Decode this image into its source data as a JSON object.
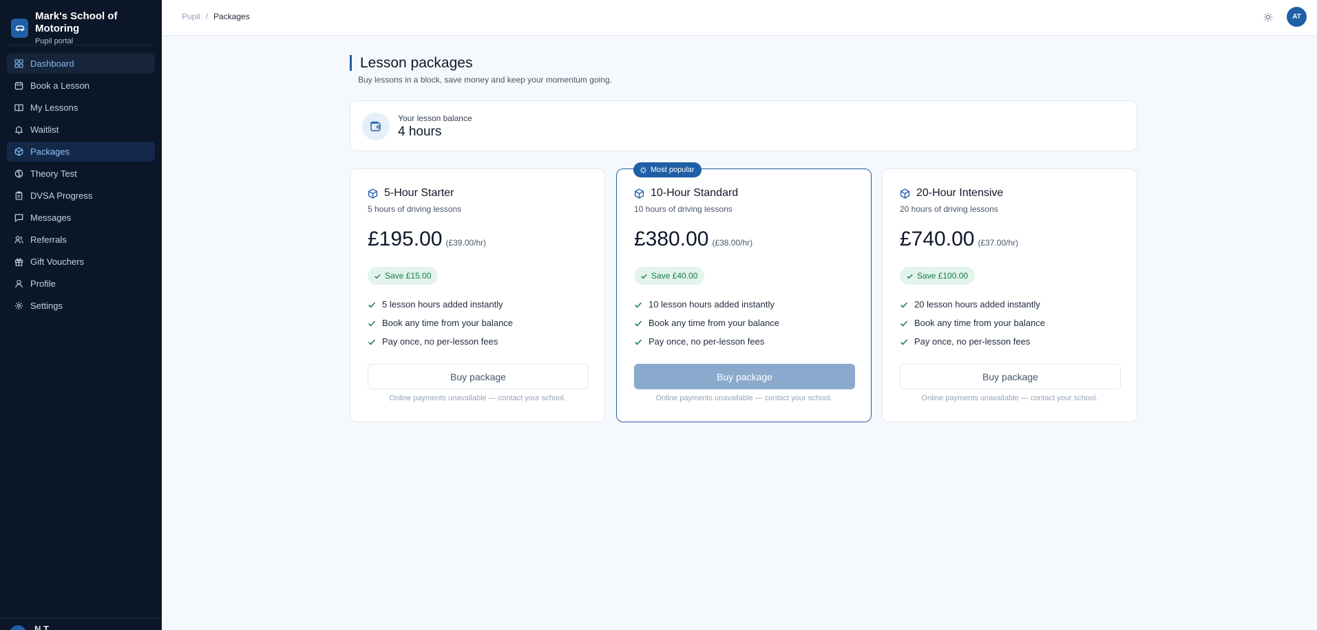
{
  "brand": {
    "name": "Mark's School of Motoring",
    "subtitle": "Pupil portal",
    "logo_icon": "car-icon"
  },
  "sidebar": {
    "items": [
      {
        "label": "Dashboard",
        "icon": "grid-icon"
      },
      {
        "label": "Book a Lesson",
        "icon": "calendar-icon"
      },
      {
        "label": "My Lessons",
        "icon": "book-icon"
      },
      {
        "label": "Waitlist",
        "icon": "bell-icon"
      },
      {
        "label": "Packages",
        "icon": "package-icon"
      },
      {
        "label": "Theory Test",
        "icon": "brain-icon"
      },
      {
        "label": "DVSA Progress",
        "icon": "clipboard-icon"
      },
      {
        "label": "Messages",
        "icon": "message-icon"
      },
      {
        "label": "Referrals",
        "icon": "users-icon"
      },
      {
        "label": "Gift Vouchers",
        "icon": "gift-icon"
      },
      {
        "label": "Profile",
        "icon": "user-icon"
      },
      {
        "label": "Settings",
        "icon": "gear-icon"
      }
    ],
    "active": "Packages",
    "footer_name": "N    T"
  },
  "topbar": {
    "breadcrumb": [
      "Pupil",
      "Packages"
    ],
    "breadcrumb_separator": "/",
    "avatar_initials": "AT",
    "theme_icon": "sun-icon"
  },
  "main": {
    "title": "Lesson packages",
    "subtitle": "Buy lessons in a block, save money and keep your momentum going.",
    "balance": {
      "label": "Your lesson balance",
      "value": "4 hours",
      "icon": "wallet-icon"
    },
    "packages": [
      {
        "name": "5-Hour Starter",
        "description": "5 hours of driving lessons",
        "price": "£195.00",
        "rate": "(£39.00/hr)",
        "save": "Save £15.00",
        "features": [
          "5 lesson hours added instantly",
          "Book any time from your balance",
          "Pay once, no per-lesson fees"
        ],
        "button": "Buy package",
        "note": "Online payments unavailable — contact your school."
      },
      {
        "name": "10-Hour Standard",
        "badge": "Most popular",
        "description": "10 hours of driving lessons",
        "price": "£380.00",
        "rate": "(£38.00/hr)",
        "save": "Save £40.00",
        "features": [
          "10 lesson hours added instantly",
          "Book any time from your balance",
          "Pay once, no per-lesson fees"
        ],
        "button": "Buy package",
        "note": "Online payments unavailable — contact your school."
      },
      {
        "name": "20-Hour Intensive",
        "description": "20 hours of driving lessons",
        "price": "£740.00",
        "rate": "(£37.00/hr)",
        "save": "Save £100.00",
        "features": [
          "20 lesson hours added instantly",
          "Book any time from your balance",
          "Pay once, no per-lesson fees"
        ],
        "button": "Buy package",
        "note": "Online payments unavailable — contact your school."
      }
    ]
  },
  "colors": {
    "accent": "#1f5fa6",
    "sidebar_bg": "#0b1628",
    "page_bg": "#f5f8fc",
    "save_green": "#16784f",
    "save_bg": "#e2f4ec"
  }
}
